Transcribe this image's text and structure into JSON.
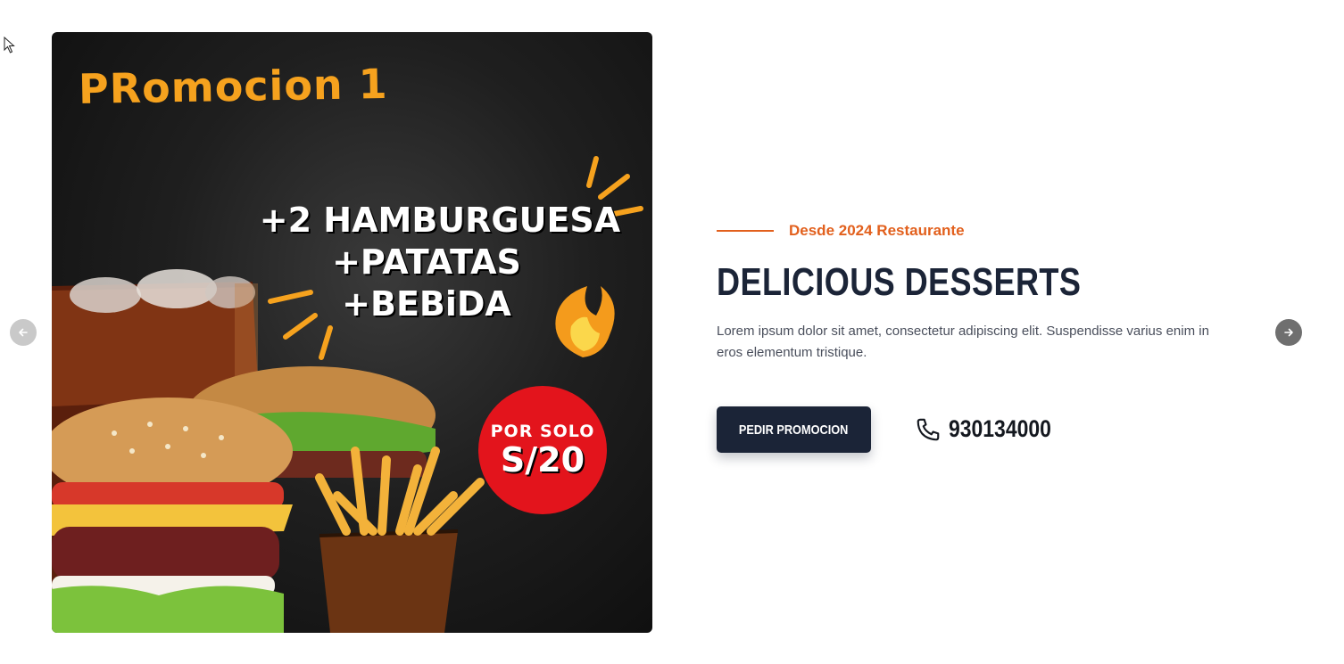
{
  "promo": {
    "title": "PRomocion 1",
    "lines": [
      "+2 HAMBURGUESA",
      "+PATATAS",
      "+BEBiDA"
    ],
    "badge_top": "POR SOLO",
    "badge_price": "S/20"
  },
  "slider": {
    "prev_icon": "arrow-left-icon",
    "next_icon": "arrow-right-icon"
  },
  "content": {
    "eyebrow": "Desde 2024 Restaurante",
    "heading": "DELICIOUS DESSERTS",
    "description": "Lorem ipsum dolor sit amet, consectetur adipiscing elit. Suspendisse varius enim in eros elementum tristique.",
    "cta_label": "PEDIR PROMOCION",
    "phone": "930134000",
    "phone_icon": "phone-icon"
  },
  "colors": {
    "accent": "#e2601d",
    "dark": "#1b2437",
    "promo_title": "#f6a21e",
    "badge": "#e3141c"
  }
}
